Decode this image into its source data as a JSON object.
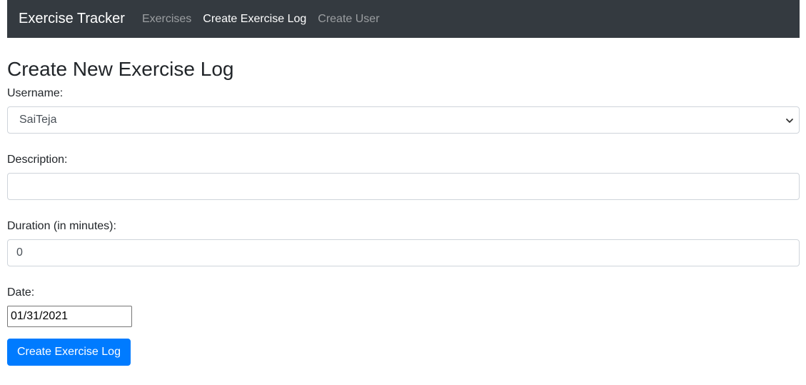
{
  "navbar": {
    "brand": "Exercise Tracker",
    "links": [
      {
        "label": "Exercises",
        "active": false
      },
      {
        "label": "Create Exercise Log",
        "active": true
      },
      {
        "label": "Create User",
        "active": false
      }
    ]
  },
  "form": {
    "title": "Create New Exercise Log",
    "username": {
      "label": "Username:",
      "value": "SaiTeja"
    },
    "description": {
      "label": "Description:",
      "value": ""
    },
    "duration": {
      "label": "Duration (in minutes):",
      "value": "0"
    },
    "date": {
      "label": "Date:",
      "value": "01/31/2021"
    },
    "submit_label": "Create Exercise Log"
  },
  "colors": {
    "navbar_bg": "#343a40",
    "primary": "#007bff"
  }
}
